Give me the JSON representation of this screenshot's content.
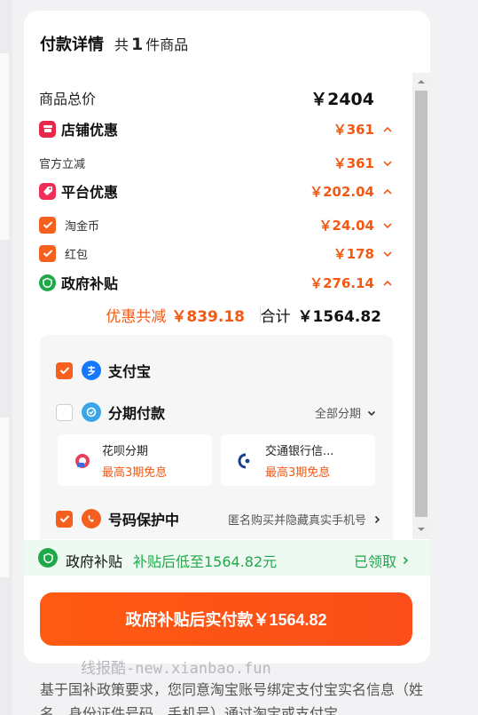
{
  "header": {
    "title": "付款详情",
    "count_prefix": "共",
    "count": "1",
    "count_suffix": "件商品"
  },
  "price_rows": {
    "total_goods": {
      "label": "商品总价",
      "amount": "￥2404"
    },
    "store_discount": {
      "label": "店铺优惠",
      "amount": "￥361"
    },
    "official_cut": {
      "label": "官方立减",
      "amount": "￥361"
    },
    "platform_discount": {
      "label": "平台优惠",
      "amount": "￥202.04"
    },
    "taojinbi": {
      "label": "淘金币",
      "amount": "￥24.04"
    },
    "hongbao": {
      "label": "红包",
      "amount": "￥178"
    },
    "gov_subsidy": {
      "label": "政府补贴",
      "amount": "￥276.14"
    }
  },
  "summary": {
    "discount_label": "优惠共减",
    "discount_amount": "￥839.18",
    "total_label": "合计",
    "total_amount": "￥1564.82"
  },
  "payment": {
    "alipay": {
      "label": "支付宝",
      "checked": true
    },
    "installment": {
      "label": "分期付款",
      "checked": false,
      "option": "全部分期"
    },
    "plans": [
      {
        "name": "花呗分期",
        "promo": "最高3期免息"
      },
      {
        "name": "交通银行信...",
        "promo": "最高3期免息"
      }
    ],
    "number_protect": {
      "label": "号码保护中",
      "desc": "匿名购买并隐藏真实手机号",
      "checked": true
    }
  },
  "subsidy_bar": {
    "label": "政府补贴",
    "detail": "补贴后低至1564.82元",
    "status": "已领取"
  },
  "pay_button": {
    "label": "政府补贴后实付款￥1564.82"
  },
  "watermark": "线报酷-new.xianbao.fun",
  "footer": {
    "text": "基于国补政策要求，您同意淘宝账号绑定支付宝实名信息（姓名、身份证件号码、手机号）通过淘宝或支付宝"
  },
  "colors": {
    "accent": "#f5601e",
    "green": "#1fa84a",
    "store_icon": "#e6284a",
    "platform_icon": "#f02e5a",
    "alipay_blue": "#1677ff"
  }
}
